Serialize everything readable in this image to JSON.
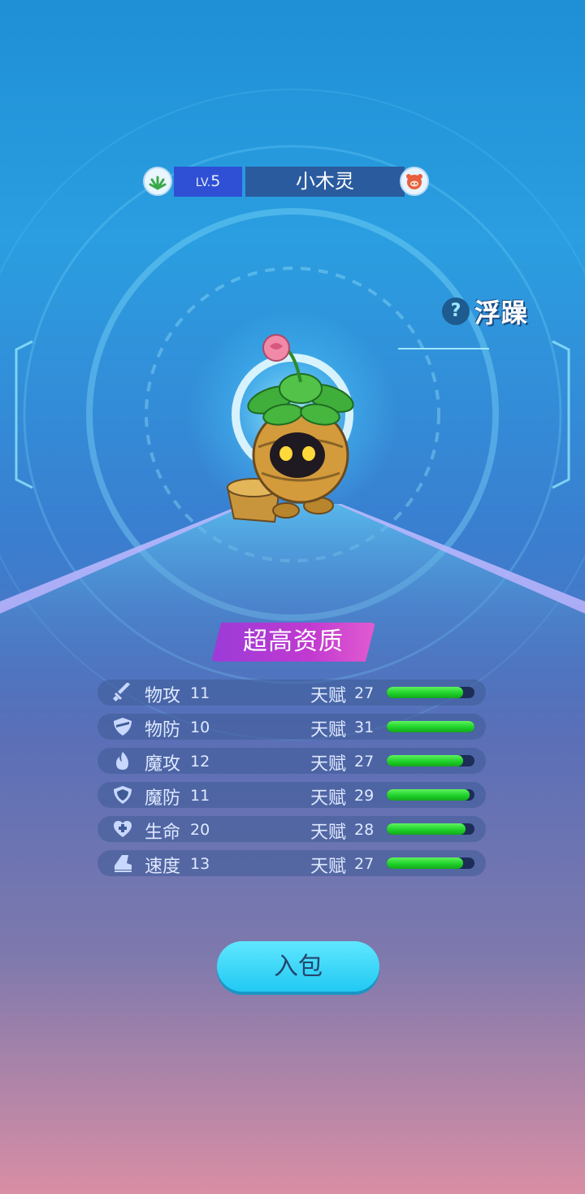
{
  "header": {
    "element_icon": "grass-element-icon",
    "level_prefix": "LV.",
    "level_value": "5",
    "pet_name": "小木灵",
    "pet_type_icon": "pig-face-icon"
  },
  "trait": {
    "help_glyph": "?",
    "label": "浮躁"
  },
  "quality": {
    "label": "超高资质"
  },
  "stats": [
    {
      "icon": "sword-icon",
      "name": "物攻",
      "value": "11",
      "talent_label": "天赋",
      "talent_value": "27",
      "fill": 0.87
    },
    {
      "icon": "shield-icon",
      "name": "物防",
      "value": "10",
      "talent_label": "天赋",
      "talent_value": "31",
      "fill": 1.0
    },
    {
      "icon": "flame-icon",
      "name": "魔攻",
      "value": "12",
      "talent_label": "天赋",
      "talent_value": "27",
      "fill": 0.87
    },
    {
      "icon": "magic-shield-icon",
      "name": "魔防",
      "value": "11",
      "talent_label": "天赋",
      "talent_value": "29",
      "fill": 0.94
    },
    {
      "icon": "heart-plus-icon",
      "name": "生命",
      "value": "20",
      "talent_label": "天赋",
      "talent_value": "28",
      "fill": 0.9
    },
    {
      "icon": "boot-icon",
      "name": "速度",
      "value": "13",
      "talent_label": "天赋",
      "talent_value": "27",
      "fill": 0.87
    }
  ],
  "button": {
    "label": "入包"
  },
  "colors": {
    "bar_fill": "#22d42c",
    "bar_track": "#1d2d57",
    "quality_gradient_start": "#9b3bd8",
    "button": "#22c9f2"
  }
}
